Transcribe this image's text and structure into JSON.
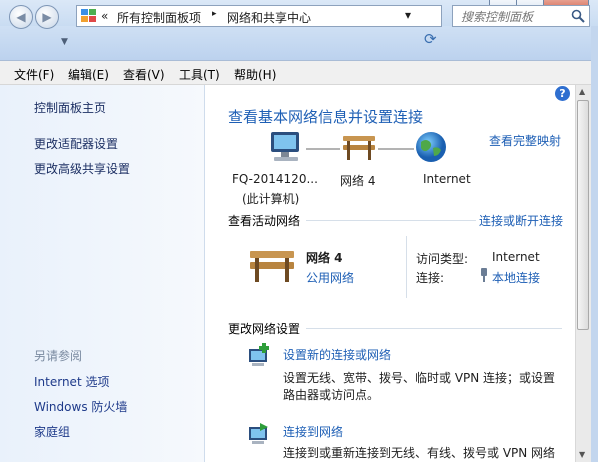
{
  "window": {
    "minimize_glyph": "─",
    "maximize_glyph": "□",
    "close_glyph": "✕"
  },
  "address": {
    "chevrons": "«",
    "crumbs": [
      "所有控制面板项",
      "网络和共享中心"
    ],
    "separator": "▸",
    "dropdown_glyph": "▾",
    "refresh_glyph": "⟳"
  },
  "search": {
    "placeholder": "搜索控制面板",
    "icon": "search-icon"
  },
  "menu": [
    "文件(F)",
    "编辑(E)",
    "查看(V)",
    "工具(T)",
    "帮助(H)"
  ],
  "sidebar": {
    "links": [
      "控制面板主页",
      "更改适配器设置",
      "更改高级共享设置"
    ],
    "see_also_title": "另请参阅",
    "see_also": [
      "Internet 选项",
      "Windows 防火墙",
      "家庭组"
    ]
  },
  "main": {
    "title": "查看基本网络信息并设置连接",
    "view_full_map": "查看完整映射",
    "map": {
      "computer_name": "FQ-2014120...",
      "computer_sub": "(此计算机)",
      "network_name": "网络  4",
      "internet": "Internet"
    },
    "active_title": "查看活动网络",
    "connect_disconnect": "连接或断开连接",
    "network": {
      "name": "网络  4",
      "type_link": "公用网络",
      "access_label": "访问类型:",
      "access_value": "Internet",
      "conn_label": "连接:",
      "conn_value": "本地连接"
    },
    "change_title": "更改网络设置",
    "tasks": [
      {
        "link": "设置新的连接或网络",
        "desc1": "设置无线、宽带、拨号、临时或 VPN 连接；或设置",
        "desc2": "路由器或访问点。"
      },
      {
        "link": "连接到网络",
        "desc1": "连接到或重新连接到无线、有线、拨号或 VPN 网络"
      }
    ]
  },
  "colors": {
    "link": "#1e5fb5",
    "title_blue": "#1e5fb5",
    "sidebar_bg": "#e9f1fb"
  }
}
